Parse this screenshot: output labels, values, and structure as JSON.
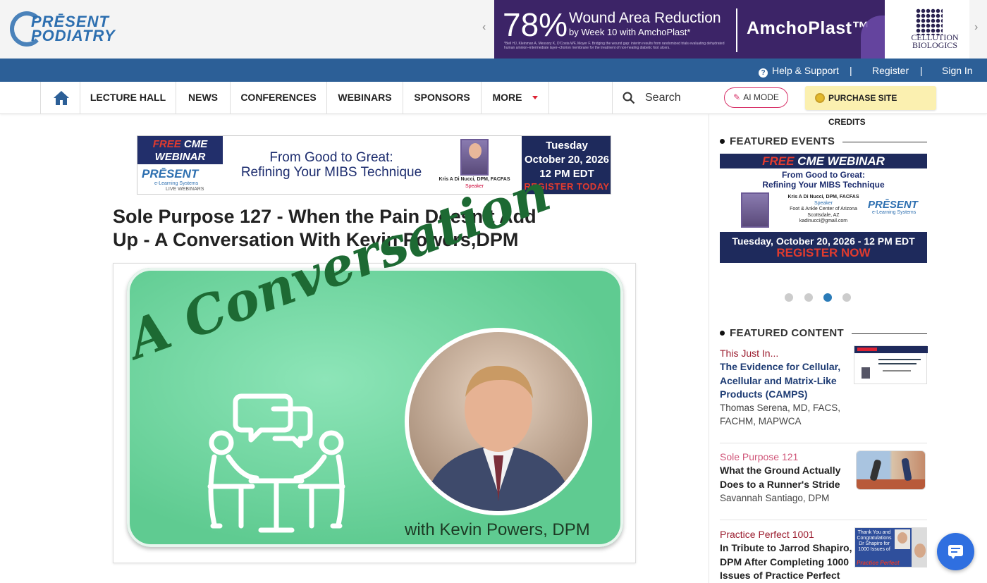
{
  "header": {
    "logo_line1": "PRĒSENT",
    "logo_line2": "PODIATRY"
  },
  "top_ad": {
    "percent": "78%",
    "headline": "Wound Area Reduction",
    "subline": "by Week 10 with AmchoPlast*",
    "fine_print": "*Bell HJ, Kleinman A, Messory K, D'Costa WF, Moyer F. Bridging the wound gap: interim results from randomized trials evaluating dehydrated human amnion–intermediate layer–chorion membrane for the treatment of non-healing diabetic foot ulcers.",
    "brand": "AmchoPlast™",
    "sponsor_line1": "CELLUTION",
    "sponsor_line2": "BIOLOGICS"
  },
  "topbar": {
    "help": "Help & Support",
    "sep": "|",
    "register": "Register",
    "signin": "Sign In"
  },
  "nav": {
    "items": [
      "LECTURE HALL",
      "NEWS",
      "CONFERENCES",
      "WEBINARS",
      "SPONSORS",
      "MORE"
    ],
    "search_placeholder": "Search",
    "ai_mode": "AI MODE",
    "purchase": "PURCHASE SITE CREDITS"
  },
  "banner": {
    "free": "FREE",
    "cme": "CME",
    "webinar": "WEBINAR",
    "logo": "PRĒSENT",
    "logo_sub": "e-Learning Systems",
    "logo_sub2": "LIVE WEBINARS",
    "title_line1": "From Good to Great:",
    "title_line2": "Refining Your MIBS Technique",
    "speaker": "Kris A Di Nucci, DPM, FACFAS",
    "speaker_role": "Speaker",
    "day": "Tuesday",
    "date": "October 20, 2026",
    "time": "12 PM EDT",
    "cta": "REGISTER TODAY"
  },
  "article": {
    "title": "Sole Purpose 127 - When the Pain Doesn’t Add Up - A Conversation With Kevin Powers,DPM",
    "hero_script": "A Conversation",
    "hero_caption": "with Kevin Powers, DPM"
  },
  "sidebar": {
    "featured_events": "FEATURED EVENTS",
    "event": {
      "free": "FREE",
      "rest": "CME WEBINAR",
      "sub1": "From Good to Great:",
      "sub2": "Refining Your MIBS Technique",
      "speaker": "Kris A Di Nucci, DPM, FACFAS",
      "role": "Speaker",
      "org": "Foot & Ankle Center of Arizona",
      "city": "Scottsdale, AZ",
      "email": "kadinucci@gmail.com",
      "logo": "PRĒSENT",
      "logo_sub": "e-Learning Systems",
      "date": "Tuesday, October 20, 2026 - 12 PM EDT",
      "cta": "REGISTER NOW"
    },
    "carousel_active": 3,
    "featured_content": "FEATURED CONTENT",
    "content": [
      {
        "kicker": "This Just In...",
        "title": "The Evidence for Cellular, Acellular and Matrix-Like Products (CAMPS)",
        "author": "Thomas Serena, MD, FACS, FACHM, MAPWCA"
      },
      {
        "kicker": "Sole Purpose 121",
        "title": "What the Ground Actually Does to a Runner's Stride",
        "author": "Savannah Santiago, DPM"
      },
      {
        "kicker": "Practice Perfect 1001",
        "title": "In Tribute to Jarrod Shapiro, DPM After Completing 1000 Issues of Practice Perfect",
        "author": ""
      }
    ],
    "thumb3_text": "Thank You and Congratulations Dr Shapiro for 1000 Issues of",
    "thumb3_brand": "Practice Perfect"
  },
  "colors": {
    "brand_blue": "#2c5f97",
    "nav_ad_purple": "#3c2467",
    "hero_green": "#62d296",
    "kicker_red": "#9b1c2e"
  }
}
